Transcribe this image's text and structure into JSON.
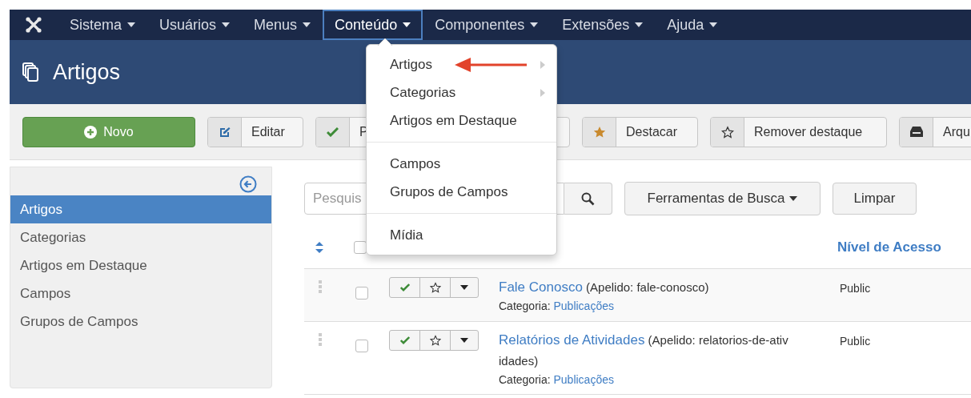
{
  "nav": {
    "menus": [
      {
        "label": "Sistema",
        "selected": false
      },
      {
        "label": "Usuários",
        "selected": false
      },
      {
        "label": "Menus",
        "selected": false
      },
      {
        "label": "Conteúdo",
        "selected": true
      },
      {
        "label": "Componentes",
        "selected": false
      },
      {
        "label": "Extensões",
        "selected": false
      },
      {
        "label": "Ajuda",
        "selected": false
      }
    ]
  },
  "header": {
    "title": "Artigos"
  },
  "toolbar": {
    "buttons": [
      {
        "label": "Novo",
        "kind": "new"
      },
      {
        "label": "Editar",
        "kind": "edit"
      },
      {
        "label": "P",
        "kind": "publish"
      },
      {
        "label": "Destacar",
        "kind": "feature"
      },
      {
        "label": "Remover destaque",
        "kind": "unfeature"
      },
      {
        "label": "Arqu",
        "kind": "archive"
      }
    ]
  },
  "dropdown": {
    "groups": [
      [
        {
          "label": "Artigos",
          "submenu": true,
          "pointed": true
        },
        {
          "label": "Categorias",
          "submenu": true,
          "pointed": false
        },
        {
          "label": "Artigos em Destaque",
          "submenu": false,
          "pointed": false
        }
      ],
      [
        {
          "label": "Campos",
          "submenu": false,
          "pointed": false
        },
        {
          "label": "Grupos de Campos",
          "submenu": false,
          "pointed": false
        }
      ],
      [
        {
          "label": "Mídia",
          "submenu": false,
          "pointed": false
        }
      ]
    ]
  },
  "sidebar": {
    "items": [
      {
        "label": "Artigos",
        "selected": true
      },
      {
        "label": "Categorias",
        "selected": false
      },
      {
        "label": "Artigos em Destaque",
        "selected": false
      },
      {
        "label": "Campos",
        "selected": false
      },
      {
        "label": "Grupos de Campos",
        "selected": false
      }
    ]
  },
  "search": {
    "placeholder": "Pesquis"
  },
  "filters": {
    "tools": "Ferramentas de Busca",
    "clear": "Limpar"
  },
  "table": {
    "select_all": {
      "checked": false
    },
    "columns": [
      {
        "label": "Nível de Acesso"
      }
    ],
    "rows": [
      {
        "title": "Fale Conosco",
        "alias": "(Apelido: fale-conosco)",
        "category_label": "Categoria:",
        "category": "Publicações",
        "access": "Public",
        "published": true,
        "featured": false,
        "checked": false
      },
      {
        "title": "Relatórios de Atividades",
        "alias": "(Apelido: relatorios-de-atividades)",
        "category_label": "Categoria:",
        "category": "Publicações",
        "access": "Public",
        "published": true,
        "featured": false,
        "checked": false
      }
    ]
  }
}
